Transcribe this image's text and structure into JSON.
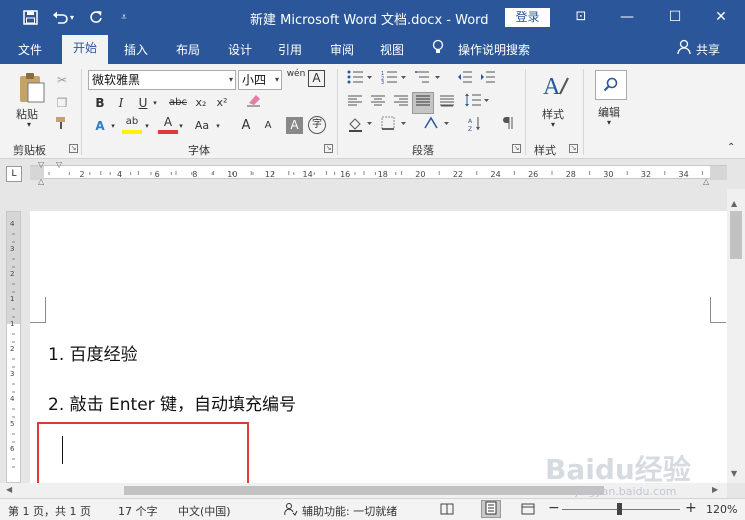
{
  "window": {
    "title": "新建 Microsoft Word 文档.docx - Word",
    "login": "登录",
    "share": "共享",
    "minimize": "—",
    "maximize": "☐",
    "close": "✕",
    "ribbon_options": "⊡"
  },
  "tabs": [
    "文件",
    "开始",
    "插入",
    "布局",
    "设计",
    "引用",
    "审阅",
    "视图"
  ],
  "tell_me": "操作说明搜索",
  "ribbon": {
    "clipboard": {
      "paste": "粘贴",
      "label": "剪贴板"
    },
    "font": {
      "name": "微软雅黑",
      "size": "小四",
      "label": "字体",
      "bold": "B",
      "italic": "I",
      "underline": "U",
      "strike": "abc",
      "sub": "x₂",
      "sup": "x²",
      "grow": "A",
      "shrink": "A",
      "clear": "Aa",
      "char_border": "A",
      "phonetic": "wén",
      "text_effect": "A",
      "highlight": "ab",
      "font_color": "A",
      "char_shade": "A",
      "enclose": "字"
    },
    "paragraph": {
      "label": "段落"
    },
    "styles": {
      "button": "样式",
      "label": "样式"
    },
    "editing": {
      "button": "编辑"
    }
  },
  "ruler": {
    "h_numbers": [
      "2",
      "4",
      "6",
      "8",
      "10",
      "12",
      "14",
      "16",
      "18",
      "20",
      "22",
      "24",
      "26",
      "28",
      "30",
      "32",
      "34"
    ],
    "v_numbers": [
      "4",
      "3",
      "2",
      "1",
      "1",
      "2",
      "3",
      "4",
      "5",
      "6"
    ],
    "tab_selector": "L"
  },
  "document": {
    "lines": [
      "1.  百度经验",
      "2.  敲击 Enter 键，自动填充编号"
    ]
  },
  "status": {
    "page": "第 1 页，共 1 页",
    "words": "17 个字",
    "language": "中文(中国)",
    "accessibility": "辅助功能: 一切就绪",
    "zoom": "120%",
    "zoom_minus": "−",
    "zoom_plus": "+"
  },
  "watermark": {
    "text": "Baidu经验",
    "sub": "jingyan.baidu.com"
  },
  "colors": {
    "brand": "#2B579A",
    "ribbon_bg": "#F3F3F3",
    "highlight_box": "#E0393A",
    "font_color_bar": "#E0393A",
    "highlight_bar": "#FFF200"
  },
  "icons": [
    "save-icon",
    "undo-icon",
    "redo-icon",
    "customize-icon",
    "lightbulb-icon",
    "person-icon",
    "paste-icon",
    "cut-icon",
    "copy-icon",
    "format-painter-icon",
    "styles-icon",
    "find-icon"
  ]
}
